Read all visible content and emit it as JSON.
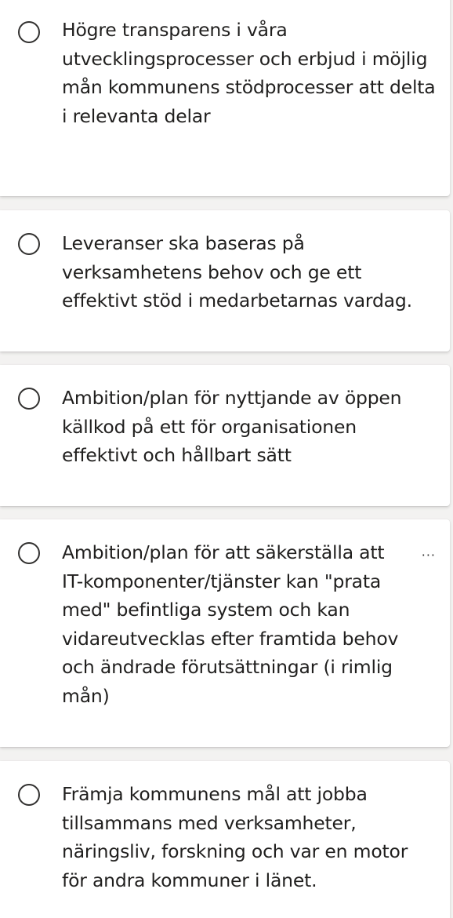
{
  "options": [
    {
      "label": "Högre transparens i våra utvecklingsprocesser och erbjud i möjlig mån kommunens stödprocesser att delta i relevanta delar",
      "selected": false
    },
    {
      "label": "Leveranser ska baseras på verksamhetens behov och ge ett effektivt stöd i medarbetarnas vardag.",
      "selected": false
    },
    {
      "label": "Ambition/plan för nyttjande av öppen källkod på ett för organisationen effektivt och hållbart sätt",
      "selected": false
    },
    {
      "label": "Ambition/plan för att säkerställa att IT-komponenter/tjänster kan \"prata med\" befintliga system och kan vidareutvecklas efter framtida behov och ändrade förutsättningar (i rimlig mån)",
      "selected": false,
      "more_icon": "more-horizontal-icon",
      "more_text": "···"
    },
    {
      "label": "Främja kommunens mål att jobba tillsammans med verksamheter, näringsliv, forskning och var en motor för andra kommuner i länet.",
      "selected": false
    }
  ]
}
